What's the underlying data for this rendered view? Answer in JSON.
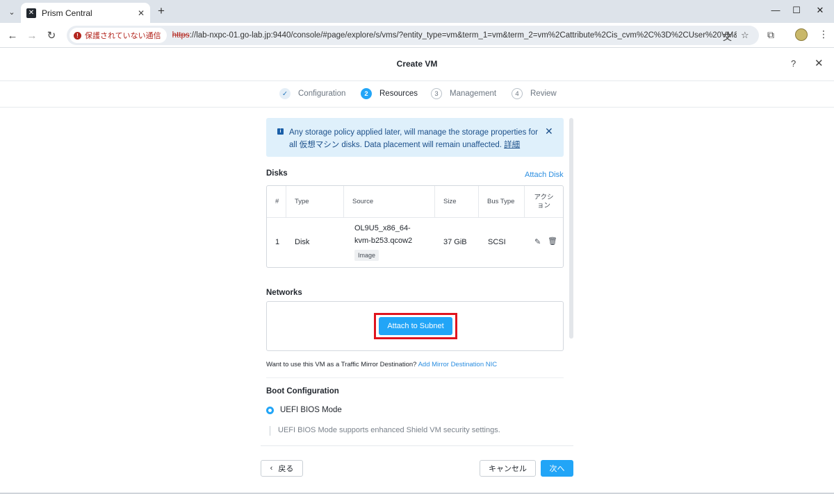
{
  "browser": {
    "tab_title": "Prism Central",
    "security_label": "保護されていない通信",
    "url_scheme": "https",
    "url_rest": "://lab-nxpc-01.go-lab.jp:9440/console/#page/explore/s/vms/?entity_type=vm&term_1=vm&term_2=vm%2Cattribute%2Cis_cvm%2C%3D%2CUser%20VM&term..."
  },
  "modal": {
    "title": "Create VM",
    "help": "?",
    "close": "✕"
  },
  "steps": [
    {
      "num": "✓",
      "label": "Configuration",
      "state": "done"
    },
    {
      "num": "2",
      "label": "Resources",
      "state": "active"
    },
    {
      "num": "3",
      "label": "Management",
      "state": "pending"
    },
    {
      "num": "4",
      "label": "Review",
      "state": "pending"
    }
  ],
  "banner": {
    "text": "Any storage policy applied later, will manage the storage properties for all 仮想マシン disks. Data placement will remain unaffected.",
    "link": "詳細"
  },
  "disks": {
    "title": "Disks",
    "attach_link": "Attach Disk",
    "headers": [
      "#",
      "Type",
      "Source",
      "Size",
      "Bus Type",
      "アクシ",
      "ョン"
    ],
    "row": {
      "num": "1",
      "type": "Disk",
      "source_line1": "OL9U5_x86_64-",
      "source_line2": "kvm-b253.qcow2",
      "source_badge": "Image",
      "size": "37 GiB",
      "bus": "SCSI"
    }
  },
  "networks": {
    "title": "Networks",
    "attach_button": "Attach to Subnet"
  },
  "mirror": {
    "text": "Want to use this VM as a Traffic Mirror Destination?",
    "link": "Add Mirror Destination NIC"
  },
  "boot": {
    "title": "Boot Configuration",
    "option": "UEFI BIOS Mode",
    "desc": "UEFI BIOS Mode supports enhanced Shield VM security settings."
  },
  "footer": {
    "back": "戻る",
    "back_icon": "‹",
    "cancel": "キャンセル",
    "next": "次へ"
  }
}
